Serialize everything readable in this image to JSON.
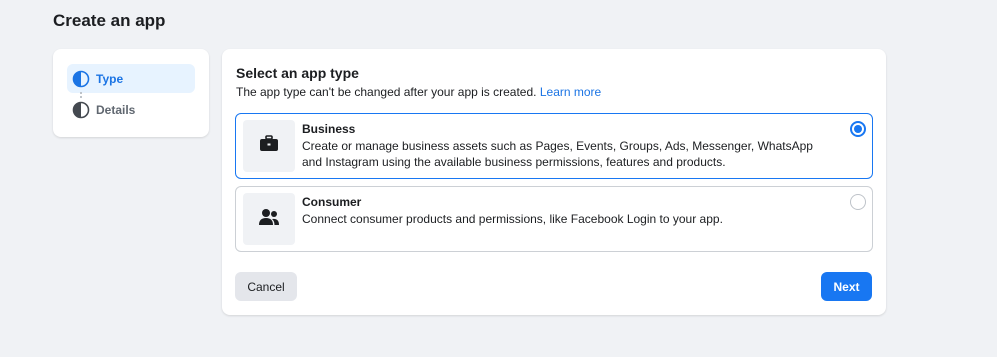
{
  "page": {
    "title": "Create an app"
  },
  "stepper": {
    "steps": [
      {
        "label": "Type",
        "state": "active"
      },
      {
        "label": "Details",
        "state": "inactive"
      }
    ]
  },
  "card": {
    "title": "Select an app type",
    "subtitle": "The app type can't be changed after your app is created.",
    "learn_more": "Learn more",
    "options": [
      {
        "title": "Business",
        "description": "Create or manage business assets such as Pages, Events, Groups, Ads, Messenger, WhatsApp and Instagram using the available business permissions, features and products.",
        "icon": "briefcase-icon",
        "selected": true
      },
      {
        "title": "Consumer",
        "description": "Connect consumer products and permissions, like Facebook Login to your app.",
        "icon": "people-icon",
        "selected": false
      }
    ]
  },
  "buttons": {
    "cancel": "Cancel",
    "next": "Next"
  },
  "colors": {
    "accent": "#1877f2",
    "background": "#f0f2f5",
    "step_active_bg": "#e7f3ff"
  }
}
